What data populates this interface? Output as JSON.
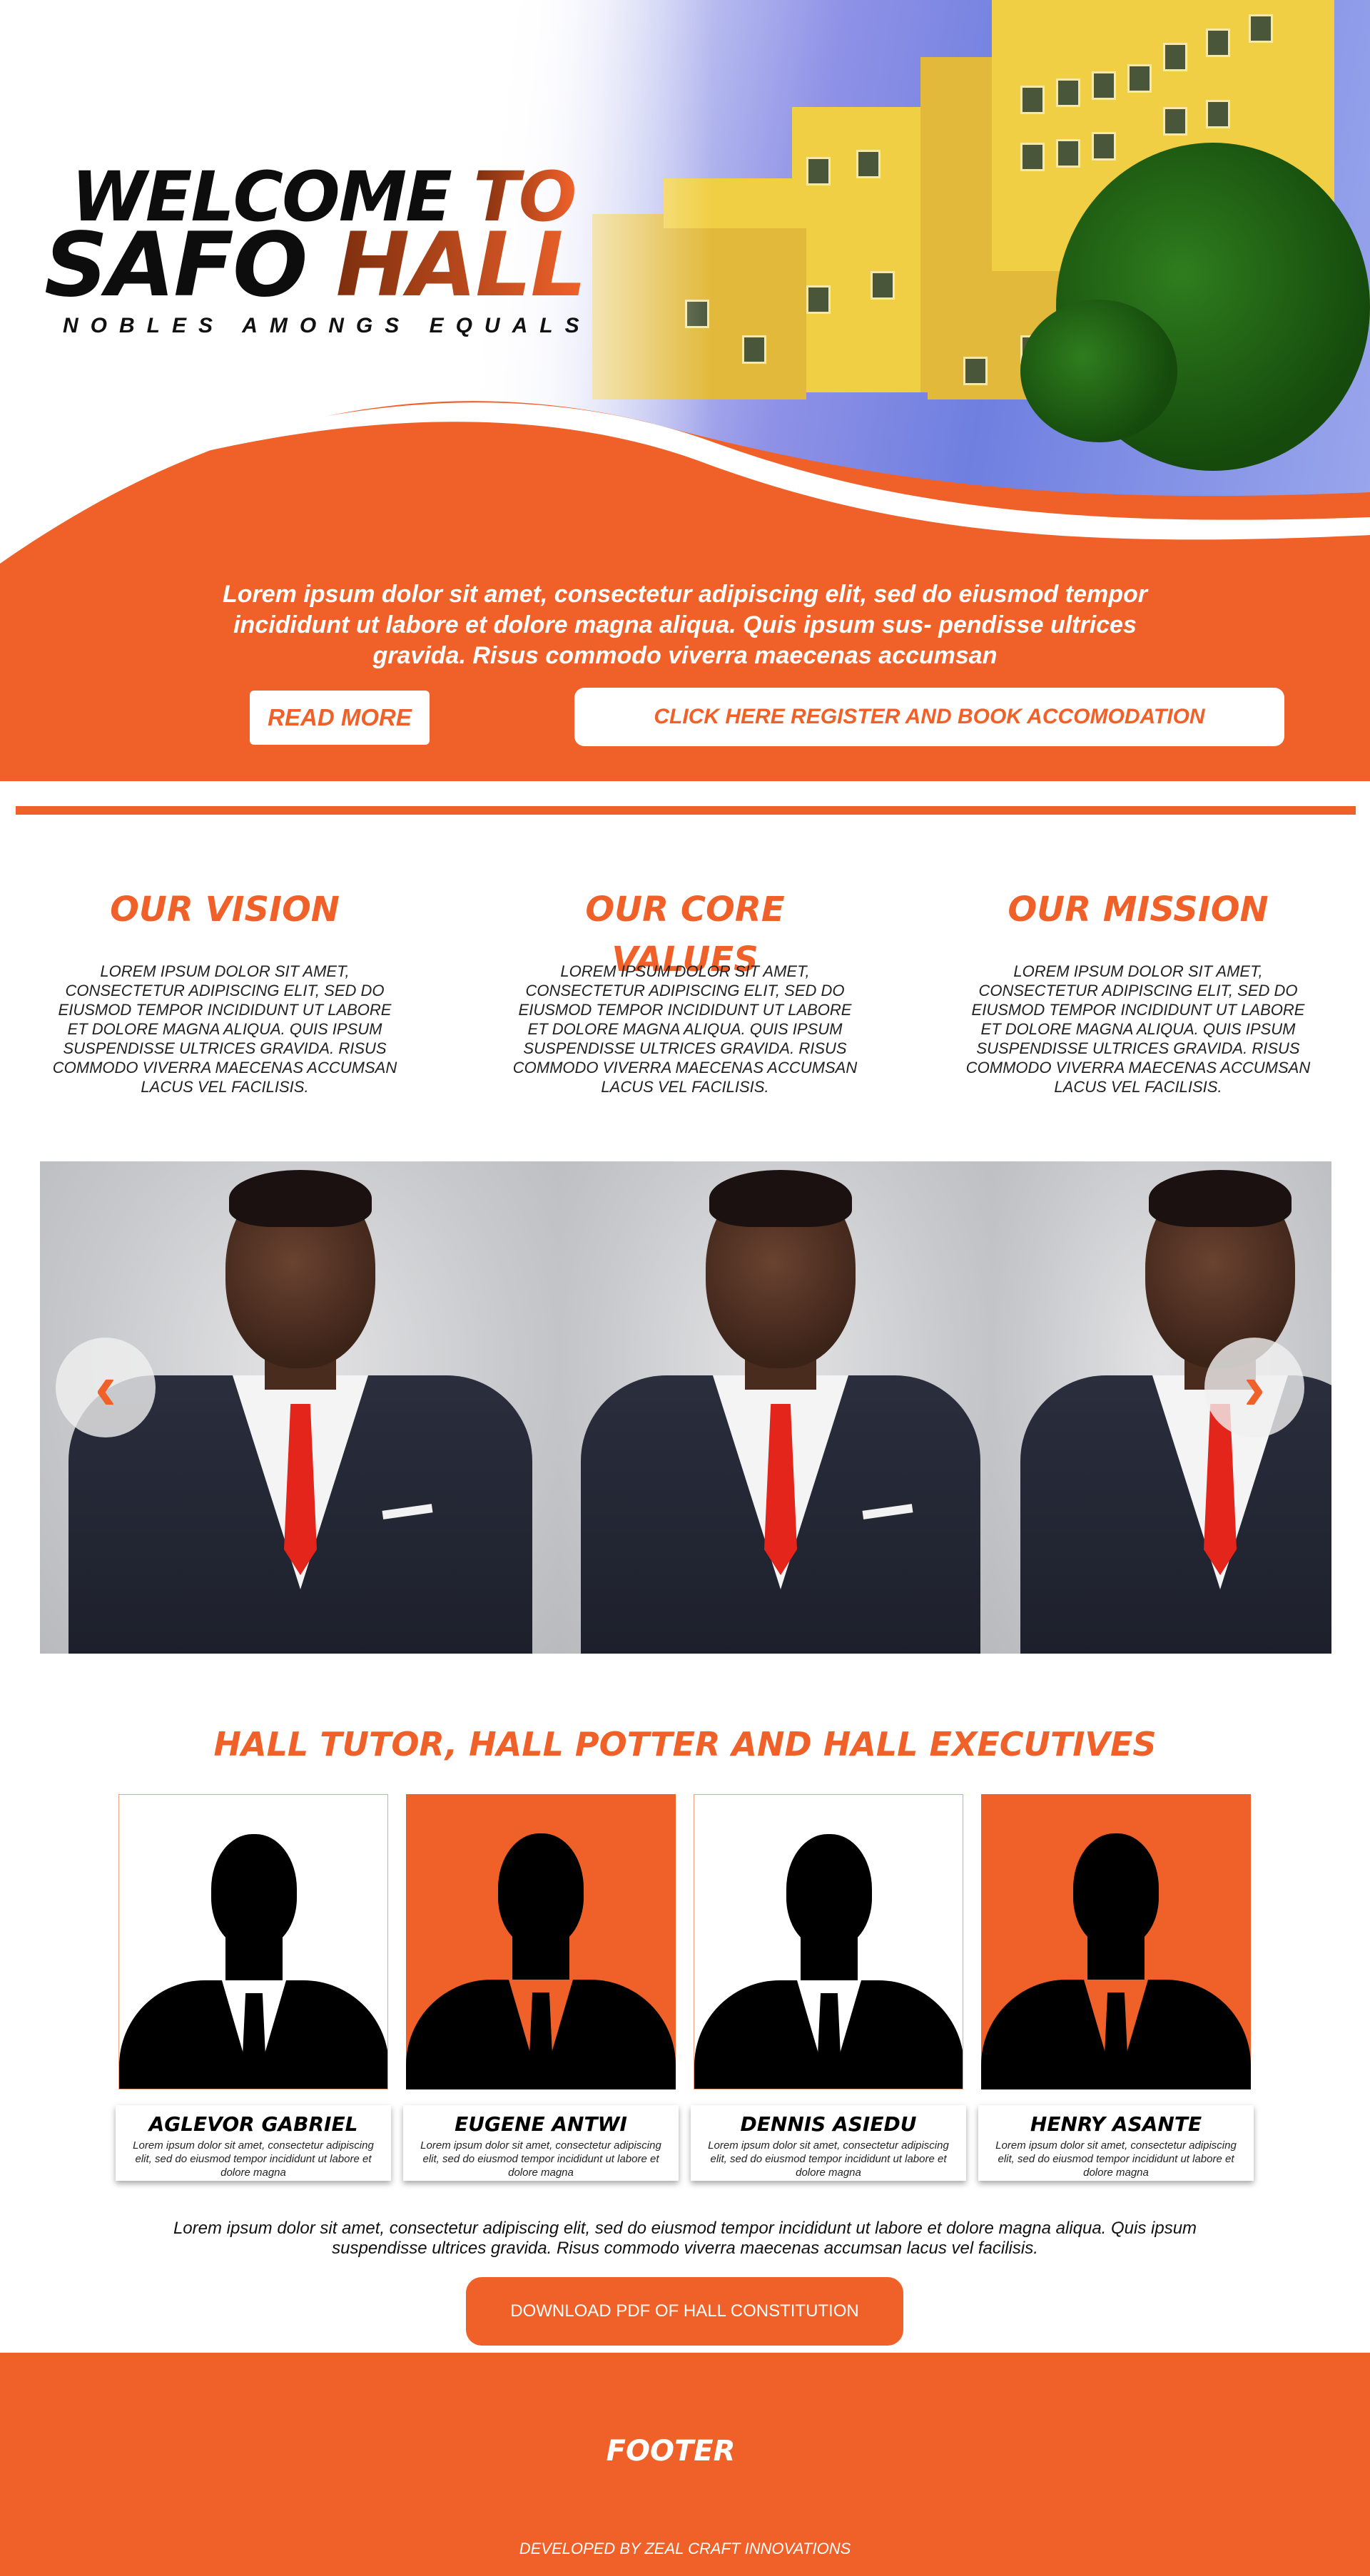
{
  "hero": {
    "welcome_word": "WELCOME",
    "to_word": "TO",
    "safo_word": "SAFO",
    "hall_word": "HALL",
    "tagline": "NOBLES AMONGS EQUALS",
    "description": "Lorem ipsum dolor sit amet, consectetur adipiscing elit, sed do eiusmod tempor incididunt ut labore et dolore magna aliqua. Quis ipsum sus- pendisse ultrices gravida. Risus commodo viverra maecenas accumsan",
    "read_more_label": "READ MORE",
    "register_label": "CLICK HERE REGISTER AND BOOK ACCOMODATION"
  },
  "sections": [
    {
      "title": "OUR VISION",
      "body": "LOREM IPSUM DOLOR SIT AMET, CONSECTETUR ADIPISCING ELIT, SED DO EIUSMOD TEMPOR INCIDIDUNT UT LABORE ET DOLORE MAGNA ALIQUA. QUIS IPSUM SUSPENDISSE ULTRICES GRAVIDA. RISUS COMMODO VIVERRA MAECENAS ACCUMSAN LACUS VEL FACILISIS."
    },
    {
      "title": "OUR CORE VALUES",
      "body": "LOREM IPSUM DOLOR SIT AMET, CONSECTETUR ADIPISCING ELIT, SED DO EIUSMOD TEMPOR INCIDIDUNT UT LABORE ET DOLORE MAGNA ALIQUA. QUIS IPSUM SUSPENDISSE ULTRICES GRAVIDA. RISUS COMMODO VIVERRA MAECENAS ACCUMSAN LACUS VEL FACILISIS."
    },
    {
      "title": "OUR MISSION",
      "body": "LOREM IPSUM DOLOR SIT AMET, CONSECTETUR ADIPISCING ELIT, SED DO EIUSMOD TEMPOR INCIDIDUNT UT LABORE ET DOLORE MAGNA ALIQUA. QUIS IPSUM SUSPENDISSE ULTRICES GRAVIDA. RISUS COMMODO VIVERRA MAECENAS ACCUMSAN LACUS VEL FACILISIS."
    }
  ],
  "carousel": {
    "prev_icon": "‹",
    "next_icon": "›",
    "prev_icon_name": "chevron-left-icon",
    "next_icon_name": "chevron-right-icon"
  },
  "executives": {
    "title": "HALL TUTOR, HALL POTTER AND HALL EXECUTIVES",
    "members": [
      {
        "name": "AGLEVOR GABRIEL",
        "desc": "Lorem ipsum dolor sit amet, consectetur adipiscing elit, sed do eiusmod tempor incididunt ut labore et dolore magna",
        "theme": "white"
      },
      {
        "name": "EUGENE ANTWI",
        "desc": "Lorem ipsum dolor sit amet, consectetur adipiscing elit, sed do eiusmod tempor incididunt ut labore et dolore magna",
        "theme": "orange"
      },
      {
        "name": "DENNIS ASIEDU",
        "desc": "Lorem ipsum dolor sit amet, consectetur adipiscing elit, sed do eiusmod tempor incididunt ut labore et dolore magna",
        "theme": "white"
      },
      {
        "name": "HENRY ASANTE",
        "desc": "Lorem ipsum dolor sit amet, consectetur adipiscing elit, sed do eiusmod tempor incididunt ut labore et dolore magna",
        "theme": "orange"
      }
    ]
  },
  "constitution": {
    "text": "Lorem ipsum dolor sit amet, consectetur adipiscing elit, sed do eiusmod tempor incididunt ut labore et dolore magna aliqua. Quis ipsum suspendisse ultrices gravida. Risus commodo viverra maecenas accumsan lacus vel facilisis.",
    "download_label": "DOWNLOAD PDF OF HALL CONSTITUTION"
  },
  "footer": {
    "title": "FOOTER",
    "credit": "DEVELOPED BY ZEAL CRAFT INNOVATIONS"
  },
  "colors": {
    "accent": "#f0612a",
    "dark": "#0d0d0d",
    "white": "#ffffff"
  }
}
